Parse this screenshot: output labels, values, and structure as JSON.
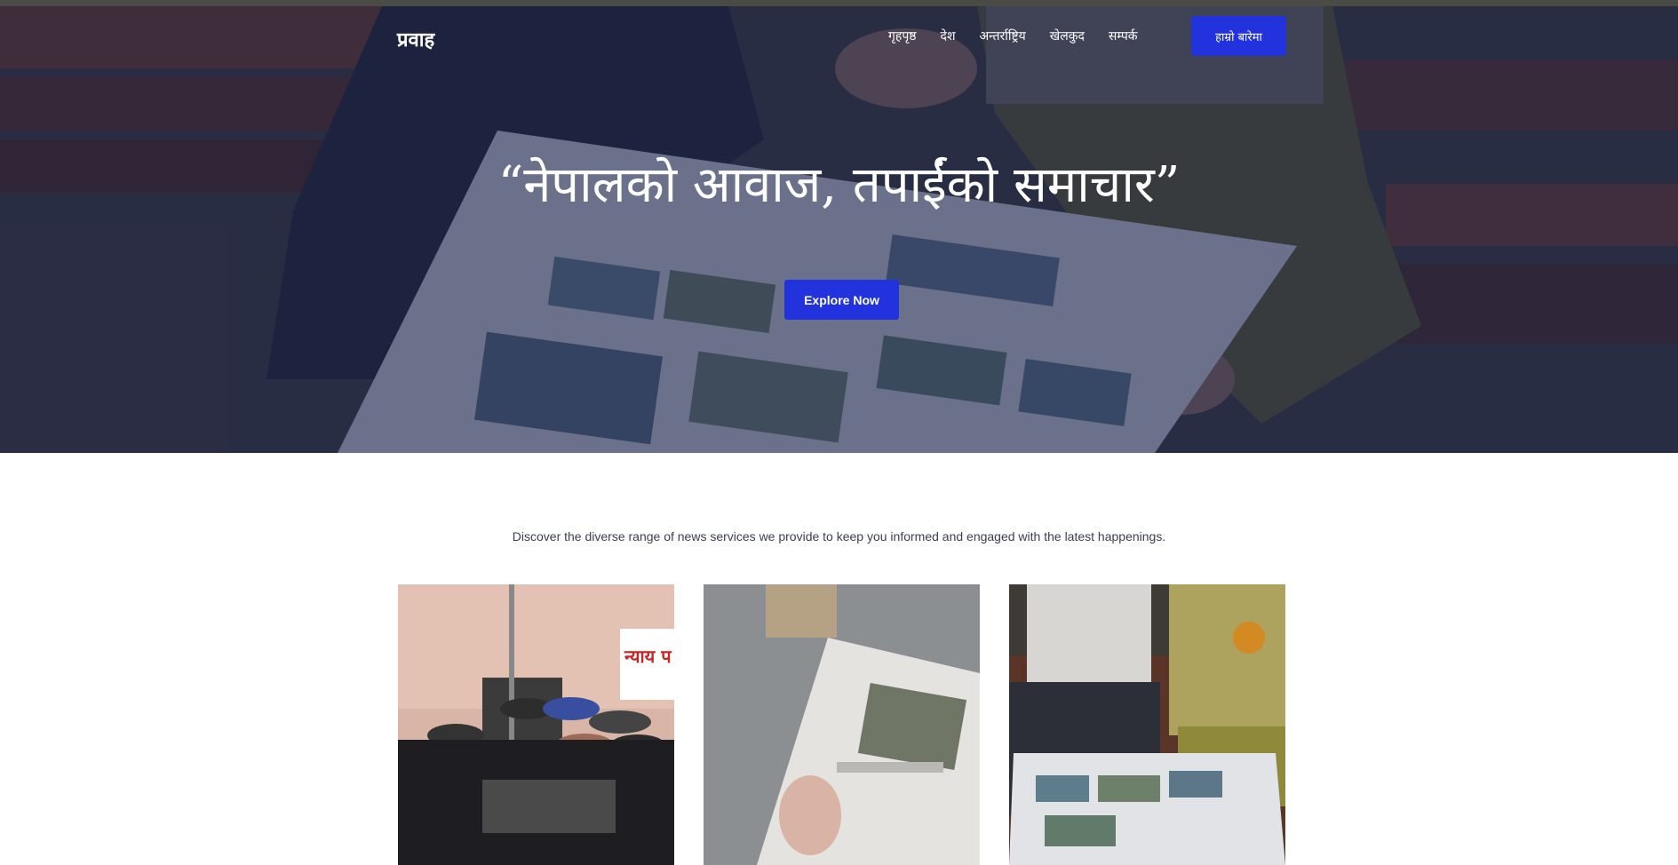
{
  "nav": {
    "logo": "प्रवाह",
    "links": [
      "गृहपृष्ठ",
      "देश",
      "अन्तर्राष्ट्रिय",
      "खेलकुद",
      "सम्पर्क"
    ],
    "about_label": "हाम्रो बारेमा"
  },
  "hero": {
    "title": "“नेपालको आवाज, तपाईंको समाचार”",
    "cta_label": "Explore Now"
  },
  "services": {
    "description": "Discover the diverse range of news services we provide to keep you informed and engaged with the latest happenings."
  },
  "cards": [
    {
      "image": "protest-with-umbrellas-photo",
      "sign_text": "न्याय प"
    },
    {
      "image": "newspaper-on-table-photo"
    },
    {
      "image": "elderly-couple-reading-photo"
    }
  ],
  "colors": {
    "accent": "#2233dd",
    "hero_overlay": "#1c224e",
    "text_muted": "#3a3f55"
  }
}
